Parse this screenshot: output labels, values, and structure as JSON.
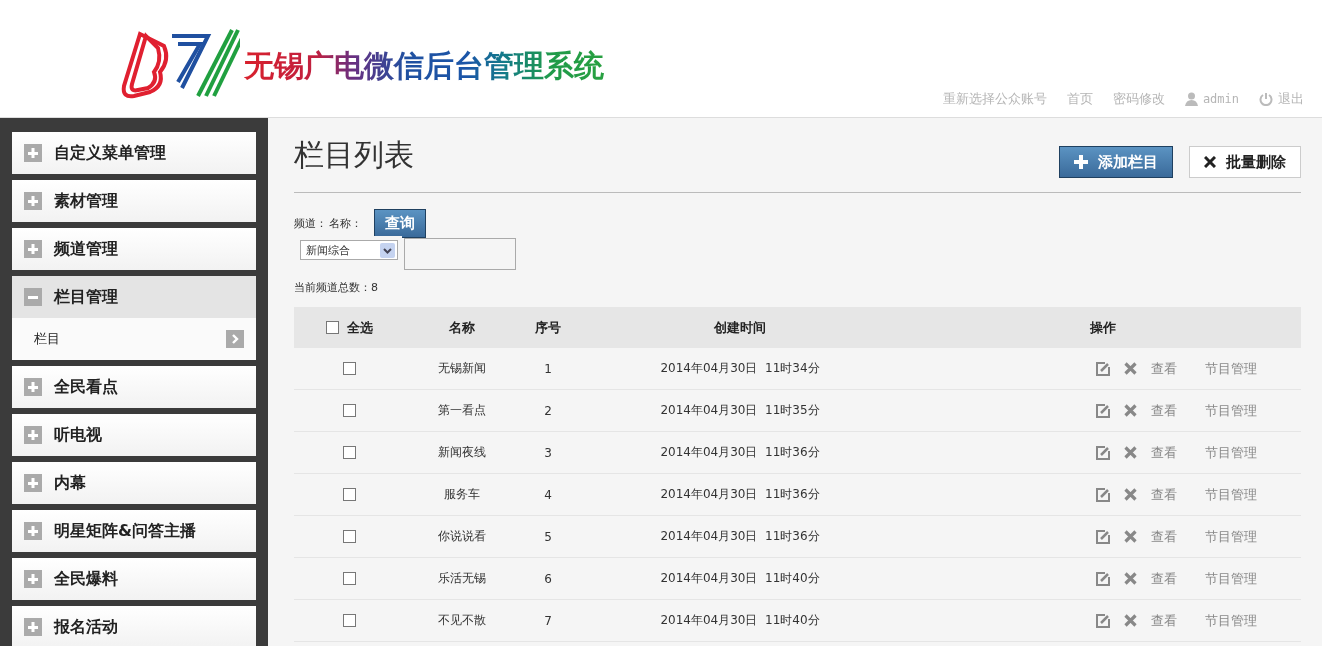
{
  "header": {
    "title": "无锡广电微信后台管理系统",
    "links": [
      {
        "label": "重新选择公众账号",
        "kind": "text"
      },
      {
        "label": "首页",
        "kind": "text"
      },
      {
        "label": "密码修改",
        "kind": "text"
      },
      {
        "label": "admin",
        "kind": "user"
      },
      {
        "label": "退出",
        "kind": "logout"
      }
    ]
  },
  "sidebar": {
    "items": [
      {
        "label": "自定义菜单管理",
        "expanded": false
      },
      {
        "label": "素材管理",
        "expanded": false
      },
      {
        "label": "频道管理",
        "expanded": false
      },
      {
        "label": "栏目管理",
        "expanded": true,
        "children": [
          {
            "label": "栏目"
          }
        ]
      },
      {
        "label": "全民看点",
        "expanded": false
      },
      {
        "label": "听电视",
        "expanded": false
      },
      {
        "label": "内幕",
        "expanded": false
      },
      {
        "label": "明星矩阵&问答主播",
        "expanded": false
      },
      {
        "label": "全民爆料",
        "expanded": false
      },
      {
        "label": "报名活动",
        "expanded": false
      }
    ]
  },
  "page": {
    "title": "栏目列表",
    "add_button": "添加栏目",
    "delete_button": "批量删除"
  },
  "filter": {
    "channel_label": "频道：",
    "name_label": "名称：",
    "query_button": "查询",
    "channel_value": "新闻综合",
    "total": "当前频道总数：8"
  },
  "table": {
    "select_all": {
      "label": "全选",
      "checked": false
    },
    "columns": [
      "名称",
      "序号",
      "创建时间",
      "操作"
    ],
    "rows": [
      {
        "checked": false,
        "name": "无锡新闻",
        "order": "1",
        "created": "2014年04月30日  11时34分",
        "view": "查看",
        "manage": "节目管理"
      },
      {
        "checked": false,
        "name": "第一看点",
        "order": "2",
        "created": "2014年04月30日  11时35分",
        "view": "查看",
        "manage": "节目管理"
      },
      {
        "checked": false,
        "name": "新闻夜线",
        "order": "3",
        "created": "2014年04月30日  11时36分",
        "view": "查看",
        "manage": "节目管理"
      },
      {
        "checked": false,
        "name": "服务车",
        "order": "4",
        "created": "2014年04月30日  11时36分",
        "view": "查看",
        "manage": "节目管理"
      },
      {
        "checked": false,
        "name": "你说说看",
        "order": "5",
        "created": "2014年04月30日  11时36分",
        "view": "查看",
        "manage": "节目管理"
      },
      {
        "checked": false,
        "name": "乐活无锡",
        "order": "6",
        "created": "2014年04月30日  11时40分",
        "view": "查看",
        "manage": "节目管理"
      },
      {
        "checked": false,
        "name": "不见不散",
        "order": "7",
        "created": "2014年04月30日  11时40分",
        "view": "查看",
        "manage": "节目管理"
      }
    ]
  }
}
